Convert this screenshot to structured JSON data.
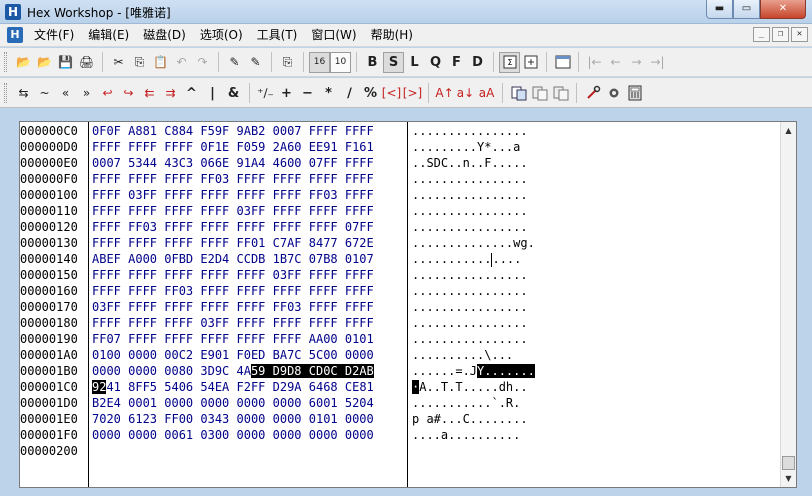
{
  "window": {
    "title": "Hex Workshop - [唯雅诺]",
    "app_icon_glyph": "H",
    "min_glyph": "▬",
    "max_glyph": "▭",
    "close_glyph": "✕"
  },
  "menu": {
    "doc_icon_glyph": "H",
    "items": [
      "文件(F)",
      "编辑(E)",
      "磁盘(D)",
      "选项(O)",
      "工具(T)",
      "窗口(W)",
      "帮助(H)"
    ],
    "mdi_min": "_",
    "mdi_restore": "❐",
    "mdi_close": "✕"
  },
  "toolbar1": {
    "icons": {
      "open": "📂",
      "open2": "📂",
      "save": "💾",
      "print": "🖨",
      "cut": "✂",
      "copy": "⎘",
      "paste": "📋",
      "undo": "↶",
      "redo": "↷",
      "find": "✎",
      "find_next": "✎",
      "replace": "⎘",
      "base16": "16",
      "base10": "10",
      "nav_first": "|←",
      "nav_back": "←",
      "nav_fwd": "→",
      "nav_last": "→|"
    },
    "data_type_labels": [
      "B",
      "S",
      "L",
      "Q",
      "F",
      "D"
    ]
  },
  "toolbar2": {
    "ops": [
      "⇆",
      "~",
      "«",
      "»",
      "↩",
      "↪",
      "⇇",
      "⇉",
      "^",
      "|",
      "&",
      "⁺∕₋",
      "+",
      "−",
      "*",
      "∕",
      "%",
      "[<]",
      "[>]",
      "A↑",
      "a↓",
      "aA"
    ]
  },
  "editor": {
    "addresses": [
      "000000C0",
      "000000D0",
      "000000E0",
      "000000F0",
      "00000100",
      "00000110",
      "00000120",
      "00000130",
      "00000140",
      "00000150",
      "00000160",
      "00000170",
      "00000180",
      "00000190",
      "000001A0",
      "000001B0",
      "000001C0",
      "000001D0",
      "000001E0",
      "000001F0",
      "00000200"
    ],
    "hex_rows": [
      "0F0F A881 C884 F59F 9AB2 0007 FFFF FFFF",
      "FFFF FFFF FFFF 0F1E F059 2A60 EE91 F161",
      "0007 5344 43C3 066E 91A4 4600 07FF FFFF",
      "FFFF FFFF FFFF FF03 FFFF FFFF FFFF FFFF",
      "FFFF 03FF FFFF FFFF FFFF FFFF FF03 FFFF",
      "FFFF FFFF FFFF FFFF 03FF FFFF FFFF FFFF",
      "FFFF FF03 FFFF FFFF FFFF FFFF FFFF 07FF",
      "FFFF FFFF FFFF FFFF FF01 C7AF 8477 672E",
      "ABEF A000 0FBD E2D4 CCDB 1B7C 07B8 0107",
      "FFFF FFFF FFFF FFFF FFFF 03FF FFFF FFFF",
      "FFFF FFFF FF03 FFFF FFFF FFFF FFFF FFFF",
      "03FF FFFF FFFF FFFF FFFF FF03 FFFF FFFF",
      "FFFF FFFF FFFF 03FF FFFF FFFF FFFF FFFF",
      "FF07 FFFF FFFF FFFF FFFF FFFF AA00 0101",
      "0100 0000 00C2 E901 F0ED BA7C 5C00 0000",
      "0000 0000 0080 3D9C 4A",
      "",
      "B2E4 0001 0000 0000 0000 0000 6001 5204",
      "7020 6123 FF00 0343 0000 0000 0101 0000",
      "0000 0000 0061 0300 0000 0000 0000 0000",
      ""
    ],
    "hex_row_1B0_selected": "59 D9D8 CD0C D2AB",
    "hex_row_1C0_selected": "92",
    "hex_row_1C0_rest": "41 8FF5 5406 54EA F2FF D29A 6468 CE81",
    "ascii_rows": [
      "................",
      ".........Y*...a",
      "..SDC..n..F.....",
      "................",
      "................",
      "................",
      "................",
      "..............wg.",
      "...........",
      "................",
      "................",
      "................",
      "................",
      "................",
      "..........\\...",
      "......=.J",
      "",
      "...........`.R.",
      "p a#...C........",
      "....a..........",
      ""
    ],
    "ascii_row_140_after_cursor": "....",
    "ascii_row_1B0_selected": "Y.......",
    "ascii_row_1C0_selected": "·",
    "ascii_row_1C0_rest": "A..T.T.....dh.."
  }
}
